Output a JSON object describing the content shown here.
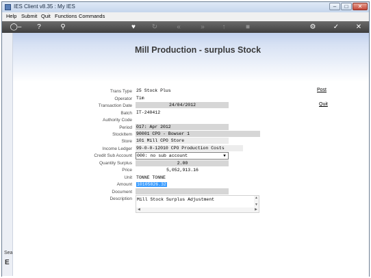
{
  "window": {
    "title": "IES Client v8.35 : My IES"
  },
  "menu": [
    "Help",
    "Submit",
    "Quit",
    "Functions",
    "Commands"
  ],
  "toolbar": {
    "icons": [
      "key-icon",
      "help-icon",
      "search-icon",
      "heart-icon",
      "refresh-icon",
      "back-icon",
      "forward-icon",
      "upload-icon",
      "stop-icon",
      "settings-icon",
      "check-icon",
      "close-icon"
    ]
  },
  "page": {
    "title": "Mill Production - surplus Stock"
  },
  "form": {
    "trans_type": {
      "label": "Trans Type",
      "value": "25 Stock Plus"
    },
    "operator": {
      "label": "Operator",
      "value": "Tim"
    },
    "transaction_date": {
      "label": "Transaction Date",
      "value": "24/04/2012"
    },
    "batch": {
      "label": "Batch",
      "value": "IT-240412"
    },
    "authority_code": {
      "label": "Authority Code",
      "value": ""
    },
    "period": {
      "label": "Period",
      "value": "017: Apr 2012"
    },
    "stockitem": {
      "label": "StockItem",
      "value": "90001 CPO - Bowser 1"
    },
    "store": {
      "label": "Store",
      "value": "101 Mill CPO Store"
    },
    "income_ledger": {
      "label": "Income Ledger",
      "value": "99-0-0-12010 CPO Production Costs"
    },
    "credit_sub_account": {
      "label": "Credit Sub Account",
      "value": "000: no sub account"
    },
    "quantity_surplus": {
      "label": "Quantity Surplus",
      "value": "2.00"
    },
    "price": {
      "label": "Price",
      "value": "5,052,913.16"
    },
    "unit": {
      "label": "Unit",
      "value": "TONNE TONNE"
    },
    "amount": {
      "label": "Amount",
      "value": "10105826.32"
    },
    "document": {
      "label": "Document",
      "value": ""
    },
    "description": {
      "label": "Description",
      "value": "Mill Stock Surplus Adjustment"
    }
  },
  "actions": {
    "post": "Post",
    "quit": "Quit"
  },
  "left_strip": {
    "text": "Sea",
    "glyph": "E"
  }
}
